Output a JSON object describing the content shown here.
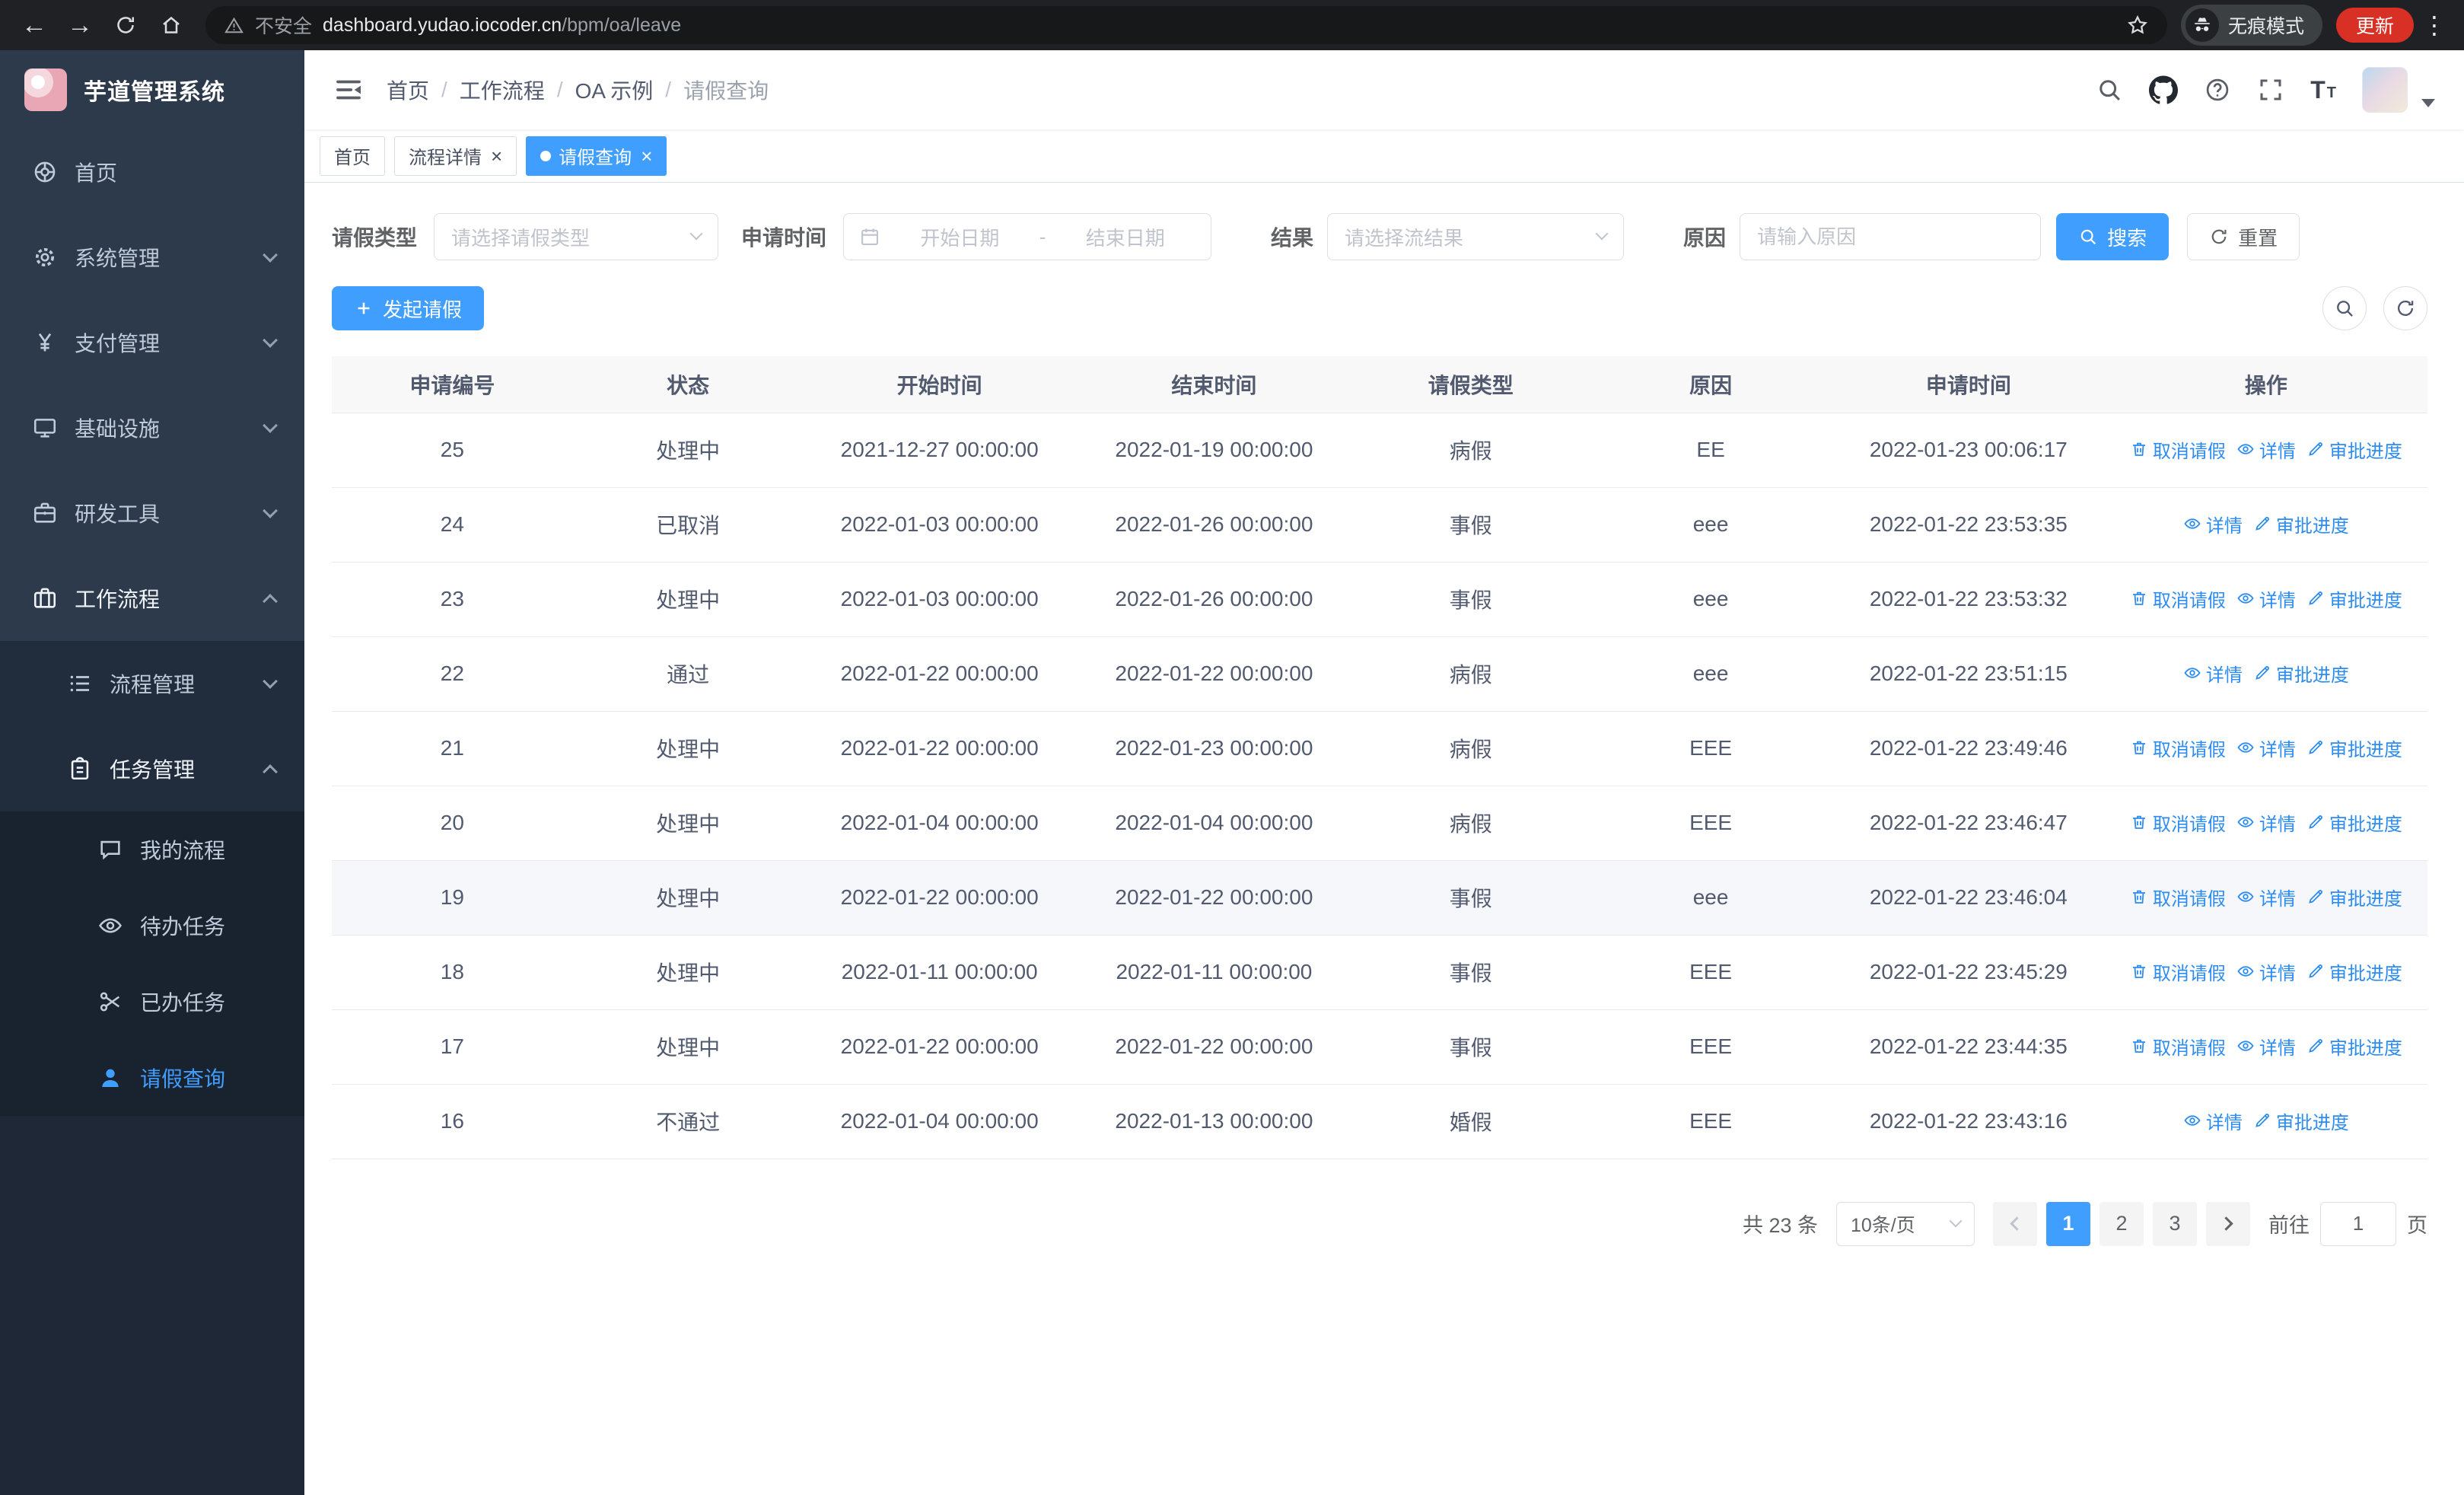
{
  "colors": {
    "accent": "#409eff",
    "link_blue": "#2d8cf0",
    "sidebar_dark": "#2d3a4b",
    "update_badge_red": "#d93025"
  },
  "ui": {
    "tab_close_glyph": "×",
    "browser_menu_glyph": "⋮",
    "back_glyph": "←",
    "forward_glyph": "→",
    "fontsize_glyph": "T"
  },
  "browser": {
    "security_label": "不安全",
    "url_domain": "dashboard.yudao.iocoder.cn",
    "url_path": "/bpm/oa/leave",
    "incognito_label": "无痕模式",
    "update_button_label": "更新"
  },
  "sidebar": {
    "logo_title": "芋道管理系统",
    "menu": [
      {
        "key": "home",
        "label": "首页",
        "icon": "dashboard-icon",
        "level": 1,
        "chevron": null,
        "active": false,
        "bright": false
      },
      {
        "key": "system-management",
        "label": "系统管理",
        "icon": "gear-icon",
        "level": 1,
        "chevron": "down",
        "active": false,
        "bright": false
      },
      {
        "key": "payment-management",
        "label": "支付管理",
        "icon": "yen-icon",
        "level": 1,
        "chevron": "down",
        "active": false,
        "bright": false
      },
      {
        "key": "infrastructure",
        "label": "基础设施",
        "icon": "monitor-icon",
        "level": 1,
        "chevron": "down",
        "active": false,
        "bright": false
      },
      {
        "key": "dev-tools",
        "label": "研发工具",
        "icon": "briefcase-icon",
        "level": 1,
        "chevron": "down",
        "active": false,
        "bright": false
      },
      {
        "key": "workflow",
        "label": "工作流程",
        "icon": "suitcase-icon",
        "level": 1,
        "chevron": "up",
        "active": false,
        "bright": true
      },
      {
        "key": "process-management",
        "label": "流程管理",
        "icon": "list-icon",
        "level": 2,
        "chevron": "down",
        "active": false,
        "bright": false
      },
      {
        "key": "task-management",
        "label": "任务管理",
        "icon": "clipboard-icon",
        "level": 2,
        "chevron": "up",
        "active": false,
        "bright": true
      },
      {
        "key": "my-process",
        "label": "我的流程",
        "icon": "chat-icon",
        "level": 3,
        "chevron": null,
        "active": false,
        "bright": false
      },
      {
        "key": "todo-tasks",
        "label": "待办任务",
        "icon": "eye-icon",
        "level": 3,
        "chevron": null,
        "active": false,
        "bright": false
      },
      {
        "key": "done-tasks",
        "label": "已办任务",
        "icon": "scissors-icon",
        "level": 3,
        "chevron": null,
        "active": false,
        "bright": false
      },
      {
        "key": "leave-query",
        "label": "请假查询",
        "icon": "user-icon",
        "level": 3,
        "chevron": null,
        "active": true,
        "bright": false
      }
    ]
  },
  "header": {
    "breadcrumb": [
      "首页",
      "工作流程",
      "OA 示例",
      "请假查询"
    ],
    "breadcrumb_separator": "/"
  },
  "tabs": [
    {
      "label": "首页",
      "active": false,
      "closable": false
    },
    {
      "label": "流程详情",
      "active": false,
      "closable": true
    },
    {
      "label": "请假查询",
      "active": true,
      "closable": true
    }
  ],
  "filters": {
    "leave_type_label": "请假类型",
    "leave_type_placeholder": "请选择请假类型",
    "apply_time_label": "申请时间",
    "start_date_placeholder": "开始日期",
    "range_separator": "-",
    "end_date_placeholder": "结束日期",
    "result_label": "结果",
    "result_placeholder": "请选择流结果",
    "reason_label": "原因",
    "reason_placeholder": "请输入原因",
    "search_button_label": "搜索",
    "reset_button_label": "重置"
  },
  "toolbar": {
    "create_button_label": "发起请假"
  },
  "table": {
    "columns": [
      "申请编号",
      "状态",
      "开始时间",
      "结束时间",
      "请假类型",
      "原因",
      "申请时间",
      "操作"
    ],
    "action_labels": {
      "cancel": "取消请假",
      "detail": "详情",
      "progress": "审批进度"
    },
    "rows": [
      {
        "id": "25",
        "status": "处理中",
        "start_time": "2021-12-27 00:00:00",
        "end_time": "2022-01-19 00:00:00",
        "leave_type": "病假",
        "reason": "EE",
        "apply_time": "2022-01-23 00:06:17",
        "actions": [
          "cancel",
          "detail",
          "progress"
        ],
        "highlighted": false
      },
      {
        "id": "24",
        "status": "已取消",
        "start_time": "2022-01-03 00:00:00",
        "end_time": "2022-01-26 00:00:00",
        "leave_type": "事假",
        "reason": "eee",
        "apply_time": "2022-01-22 23:53:35",
        "actions": [
          "detail",
          "progress"
        ],
        "highlighted": false
      },
      {
        "id": "23",
        "status": "处理中",
        "start_time": "2022-01-03 00:00:00",
        "end_time": "2022-01-26 00:00:00",
        "leave_type": "事假",
        "reason": "eee",
        "apply_time": "2022-01-22 23:53:32",
        "actions": [
          "cancel",
          "detail",
          "progress"
        ],
        "highlighted": false
      },
      {
        "id": "22",
        "status": "通过",
        "start_time": "2022-01-22 00:00:00",
        "end_time": "2022-01-22 00:00:00",
        "leave_type": "病假",
        "reason": "eee",
        "apply_time": "2022-01-22 23:51:15",
        "actions": [
          "detail",
          "progress"
        ],
        "highlighted": false
      },
      {
        "id": "21",
        "status": "处理中",
        "start_time": "2022-01-22 00:00:00",
        "end_time": "2022-01-23 00:00:00",
        "leave_type": "病假",
        "reason": "EEE",
        "apply_time": "2022-01-22 23:49:46",
        "actions": [
          "cancel",
          "detail",
          "progress"
        ],
        "highlighted": false
      },
      {
        "id": "20",
        "status": "处理中",
        "start_time": "2022-01-04 00:00:00",
        "end_time": "2022-01-04 00:00:00",
        "leave_type": "病假",
        "reason": "EEE",
        "apply_time": "2022-01-22 23:46:47",
        "actions": [
          "cancel",
          "detail",
          "progress"
        ],
        "highlighted": false
      },
      {
        "id": "19",
        "status": "处理中",
        "start_time": "2022-01-22 00:00:00",
        "end_time": "2022-01-22 00:00:00",
        "leave_type": "事假",
        "reason": "eee",
        "apply_time": "2022-01-22 23:46:04",
        "actions": [
          "cancel",
          "detail",
          "progress"
        ],
        "highlighted": true
      },
      {
        "id": "18",
        "status": "处理中",
        "start_time": "2022-01-11 00:00:00",
        "end_time": "2022-01-11 00:00:00",
        "leave_type": "事假",
        "reason": "EEE",
        "apply_time": "2022-01-22 23:45:29",
        "actions": [
          "cancel",
          "detail",
          "progress"
        ],
        "highlighted": false
      },
      {
        "id": "17",
        "status": "处理中",
        "start_time": "2022-01-22 00:00:00",
        "end_time": "2022-01-22 00:00:00",
        "leave_type": "事假",
        "reason": "EEE",
        "apply_time": "2022-01-22 23:44:35",
        "actions": [
          "cancel",
          "detail",
          "progress"
        ],
        "highlighted": false
      },
      {
        "id": "16",
        "status": "不通过",
        "start_time": "2022-01-04 00:00:00",
        "end_time": "2022-01-13 00:00:00",
        "leave_type": "婚假",
        "reason": "EEE",
        "apply_time": "2022-01-22 23:43:16",
        "actions": [
          "detail",
          "progress"
        ],
        "highlighted": false
      }
    ]
  },
  "pagination": {
    "total_label": "共 23 条",
    "page_size_label": "10条/页",
    "pages": [
      "1",
      "2",
      "3"
    ],
    "current_page": "1",
    "goto_label": "前往",
    "goto_value": "1",
    "goto_unit_label": "页"
  }
}
